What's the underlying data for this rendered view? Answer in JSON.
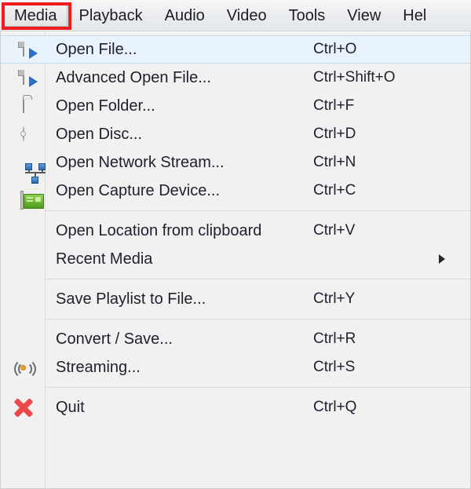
{
  "menubar": {
    "items": [
      {
        "label": "Media",
        "active": true
      },
      {
        "label": "Playback",
        "active": false
      },
      {
        "label": "Audio",
        "active": false
      },
      {
        "label": "Video",
        "active": false
      },
      {
        "label": "Tools",
        "active": false
      },
      {
        "label": "View",
        "active": false
      },
      {
        "label": "Hel",
        "active": false
      }
    ]
  },
  "menu": {
    "groups": [
      {
        "items": [
          {
            "icon": "media-file-icon",
            "label": "Open File...",
            "shortcut": "Ctrl+O",
            "selected": true,
            "submenu": false
          },
          {
            "icon": "media-file-icon",
            "label": "Advanced Open File...",
            "shortcut": "Ctrl+Shift+O",
            "selected": false,
            "submenu": false
          },
          {
            "icon": "folder-icon",
            "label": "Open Folder...",
            "shortcut": "Ctrl+F",
            "selected": false,
            "submenu": false
          },
          {
            "icon": "disc-icon",
            "label": "Open Disc...",
            "shortcut": "Ctrl+D",
            "selected": false,
            "submenu": false
          },
          {
            "icon": "network-icon",
            "label": "Open Network Stream...",
            "shortcut": "Ctrl+N",
            "selected": false,
            "submenu": false
          },
          {
            "icon": "capture-card-icon",
            "label": "Open Capture Device...",
            "shortcut": "Ctrl+C",
            "selected": false,
            "submenu": false
          }
        ]
      },
      {
        "items": [
          {
            "icon": "none",
            "label": "Open Location from clipboard",
            "shortcut": "Ctrl+V",
            "selected": false,
            "submenu": false
          },
          {
            "icon": "none",
            "label": "Recent Media",
            "shortcut": "",
            "selected": false,
            "submenu": true
          }
        ]
      },
      {
        "items": [
          {
            "icon": "none",
            "label": "Save Playlist to File...",
            "shortcut": "Ctrl+Y",
            "selected": false,
            "submenu": false
          }
        ]
      },
      {
        "items": [
          {
            "icon": "none",
            "label": "Convert / Save...",
            "shortcut": "Ctrl+R",
            "selected": false,
            "submenu": false
          },
          {
            "icon": "streaming-icon",
            "label": "Streaming...",
            "shortcut": "Ctrl+S",
            "selected": false,
            "submenu": false
          }
        ]
      },
      {
        "items": [
          {
            "icon": "quit-icon",
            "label": "Quit",
            "shortcut": "Ctrl+Q",
            "selected": false,
            "submenu": false
          }
        ]
      }
    ]
  },
  "colors": {
    "highlight_box": "#ef1d1d",
    "selected_row": "#e8f3fc",
    "accent_blue": "#2c6fc4",
    "quit_red": "#ec4a4a",
    "card_green": "#4e9c1f",
    "stream_orange": "#f0a030"
  }
}
